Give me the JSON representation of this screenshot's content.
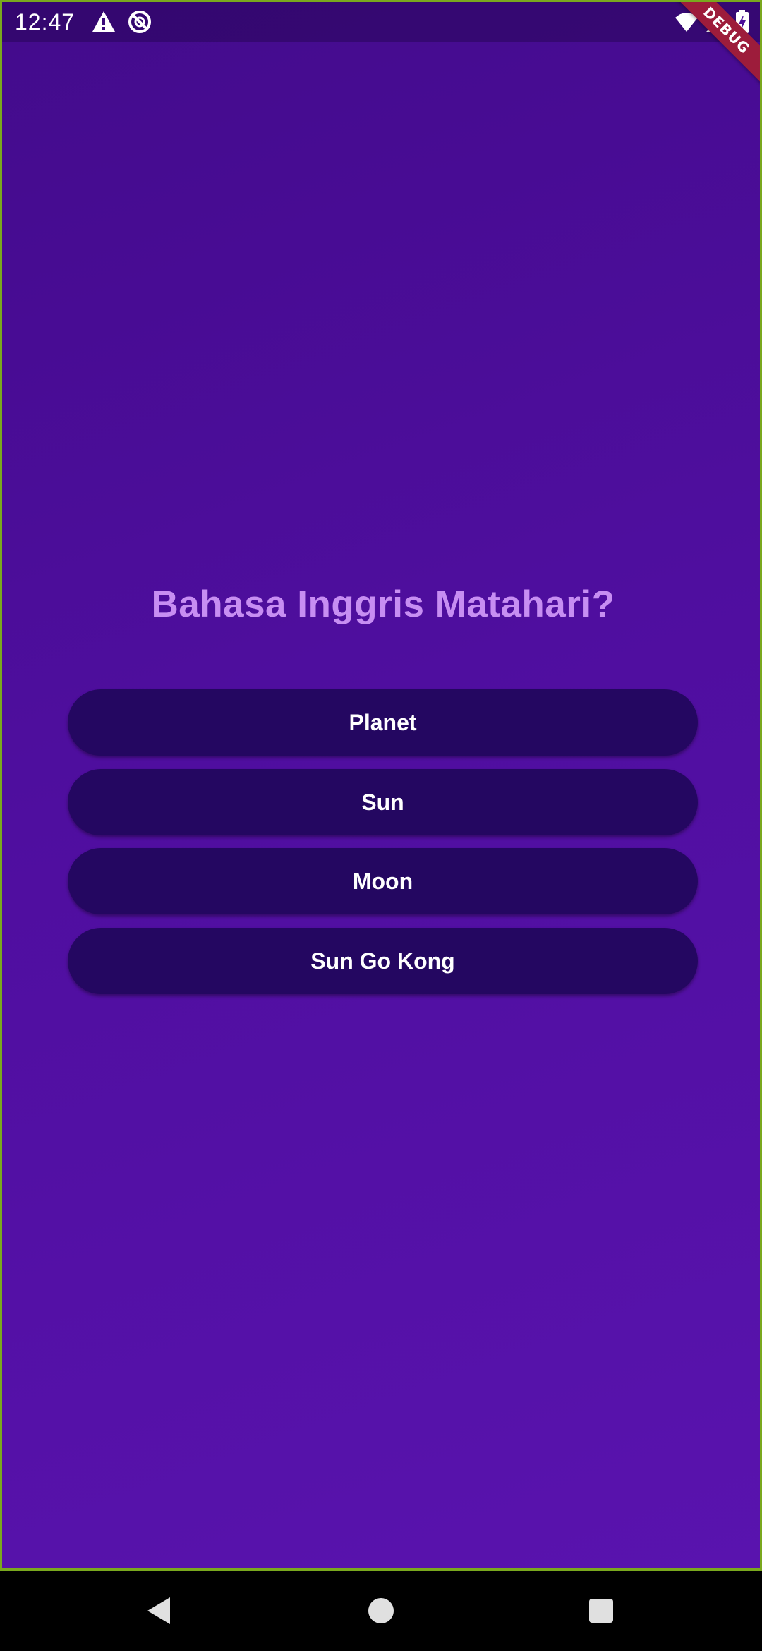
{
  "status_bar": {
    "time": "12:47",
    "left_icons": [
      "warning-icon",
      "blocked-icon"
    ],
    "right_icons": [
      "wifi-icon",
      "signal-icon",
      "battery-icon"
    ],
    "debug_label": "DEBUG"
  },
  "quiz": {
    "question": "Bahasa Inggris Matahari?",
    "answers": [
      "Planet",
      "Sun",
      "Moon",
      "Sun Go Kong"
    ]
  },
  "nav_bar": {
    "buttons": [
      "back-icon",
      "home-icon",
      "recents-icon"
    ]
  },
  "colors": {
    "background_top": "#430b8c",
    "background_bottom": "#5913ae",
    "question_text": "#c78ef2",
    "button_bg": "#240761",
    "button_text": "#ffffff",
    "debug_ribbon": "#9d1c3b"
  }
}
